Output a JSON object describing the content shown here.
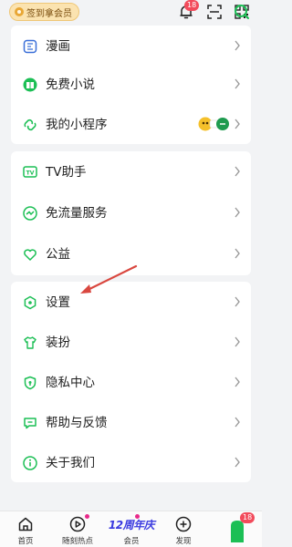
{
  "topbar": {
    "signin_label": "签到拿会员",
    "notification_badge": "18"
  },
  "menu": {
    "group1": [
      {
        "label": "漫画",
        "icon": "comic-icon"
      },
      {
        "label": "免费小说",
        "icon": "book-icon"
      },
      {
        "label": "我的小程序",
        "icon": "mini-program-icon"
      }
    ],
    "group2": [
      {
        "label": "TV助手",
        "icon": "tv-icon"
      },
      {
        "label": "免流量服务",
        "icon": "data-flow-icon"
      },
      {
        "label": "公益",
        "icon": "heart-icon"
      }
    ],
    "group3": [
      {
        "label": "设置",
        "icon": "settings-icon"
      },
      {
        "label": "装扮",
        "icon": "shirt-icon"
      },
      {
        "label": "隐私中心",
        "icon": "privacy-shield-icon"
      },
      {
        "label": "帮助与反馈",
        "icon": "help-chat-icon"
      },
      {
        "label": "关于我们",
        "icon": "info-icon"
      }
    ]
  },
  "bottom_nav": {
    "tabs": [
      {
        "label": "首页",
        "icon": "home-icon"
      },
      {
        "label": "随刻热点",
        "icon": "play-circle-icon"
      },
      {
        "label": "会员",
        "icon": "vip-anniversary-icon"
      },
      {
        "label": "发现",
        "icon": "plus-circle-icon"
      }
    ],
    "anniversary_text": "12周年庆",
    "me_badge": "18"
  },
  "colors": {
    "accent_green": "#1cbf55",
    "badge_red": "#f24b5b",
    "annotation_arrow": "#d9473f"
  }
}
